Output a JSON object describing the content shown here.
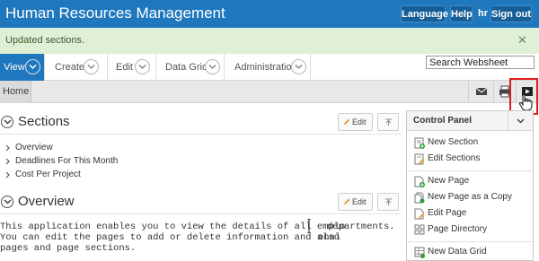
{
  "header": {
    "title": "Human Resources Management",
    "language_label": "Language",
    "help_label": "Help",
    "user": "hr",
    "signout_label": "Sign out"
  },
  "alert": {
    "message": "Updated sections.",
    "close_glyph": "✕"
  },
  "menu": {
    "tabs": [
      {
        "label": "View",
        "active": true
      },
      {
        "label": "Create",
        "active": false
      },
      {
        "label": "Edit",
        "active": false
      },
      {
        "label": "Data Grid",
        "active": false
      },
      {
        "label": "Administration",
        "active": false
      }
    ],
    "search_value": "Search Websheet"
  },
  "breadcrumb": {
    "home": "Home",
    "icons": [
      "mail-icon",
      "print-icon",
      "presentation-play-icon",
      "hand-cursor-icon"
    ]
  },
  "sections_region": {
    "title": "Sections",
    "edit_label": "Edit",
    "items": [
      "Overview",
      "Deadlines For This Month",
      "Cost Per Project"
    ]
  },
  "overview_region": {
    "title": "Overview",
    "edit_label": "Edit",
    "lines": [
      "This application enables you to view the details of all emplo",
      "departments.",
      "You can edit the pages to add or delete information and also",
      "onal",
      "pages and page sections."
    ]
  },
  "control_panel": {
    "title": "Control Panel",
    "items": [
      {
        "label": "New Section",
        "icon": "new-section-icon"
      },
      {
        "label": "Edit Sections",
        "icon": "edit-sections-icon"
      },
      {
        "label": "New Page",
        "icon": "new-page-icon"
      },
      {
        "label": "New Page as a Copy",
        "icon": "copy-page-icon"
      },
      {
        "label": "Edit Page",
        "icon": "edit-page-icon"
      },
      {
        "label": "Page Directory",
        "icon": "page-directory-icon"
      },
      {
        "label": "New Data Grid",
        "icon": "data-grid-icon"
      }
    ]
  },
  "colors": {
    "header_blue": "#1f77bd",
    "success_bg": "#dff0d6",
    "highlight_red": "#e01a1a"
  }
}
